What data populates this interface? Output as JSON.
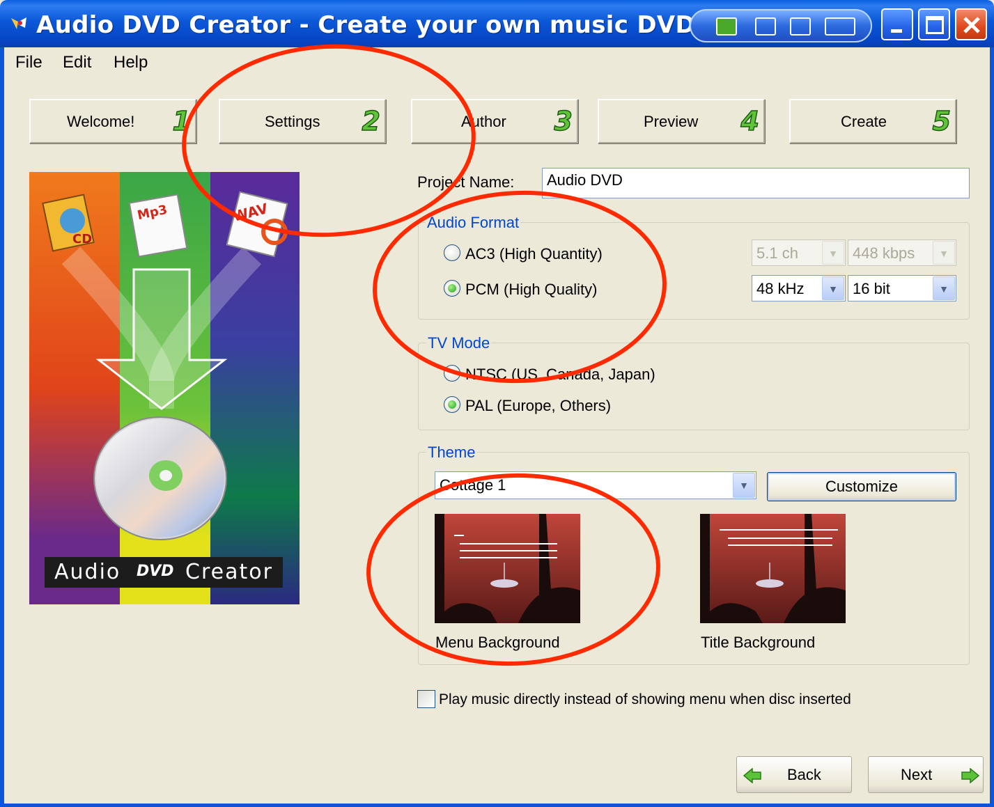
{
  "window": {
    "title": "Audio DVD Creator - Create your own music DVD and"
  },
  "menu": [
    "File",
    "Edit",
    "Help"
  ],
  "steps": [
    {
      "label": "Welcome!",
      "num": "1"
    },
    {
      "label": "Settings",
      "num": "2"
    },
    {
      "label": "Author",
      "num": "3"
    },
    {
      "label": "Preview",
      "num": "4"
    },
    {
      "label": "Create",
      "num": "5"
    }
  ],
  "banner": {
    "tags": [
      "CD",
      "Mp3",
      "WAV"
    ],
    "caption_left": "Audio",
    "caption_logo": "DVD",
    "caption_right": "Creator"
  },
  "project": {
    "label": "Project Name:",
    "value": "Audio DVD"
  },
  "audio_format": {
    "title": "Audio Format",
    "ac3_label": "AC3 (High Quantity)",
    "pcm_label": "PCM (High Quality)",
    "selected": "pcm",
    "ac3_channels": "5.1 ch",
    "ac3_bitrate": "448 kbps",
    "pcm_rate": "48 kHz",
    "pcm_bits": "16 bit"
  },
  "tv_mode": {
    "title": "TV Mode",
    "ntsc_label": "NTSC (US, Canada, Japan)",
    "pal_label": "PAL  (Europe, Others)",
    "selected": "pal"
  },
  "theme": {
    "title": "Theme",
    "selected": "Cottage 1",
    "customize_label": "Customize",
    "menu_bg_label": "Menu Background",
    "title_bg_label": "Title Background"
  },
  "play_direct": {
    "label": "Play music directly instead of showing menu when disc inserted",
    "checked": false
  },
  "nav": {
    "back_label": "Back",
    "next_label": "Next"
  },
  "colors": {
    "titlebar": "#0b58d8",
    "group_title": "#0046d5",
    "annotation": "#ff2a00",
    "step_number": "#5fc43a"
  }
}
